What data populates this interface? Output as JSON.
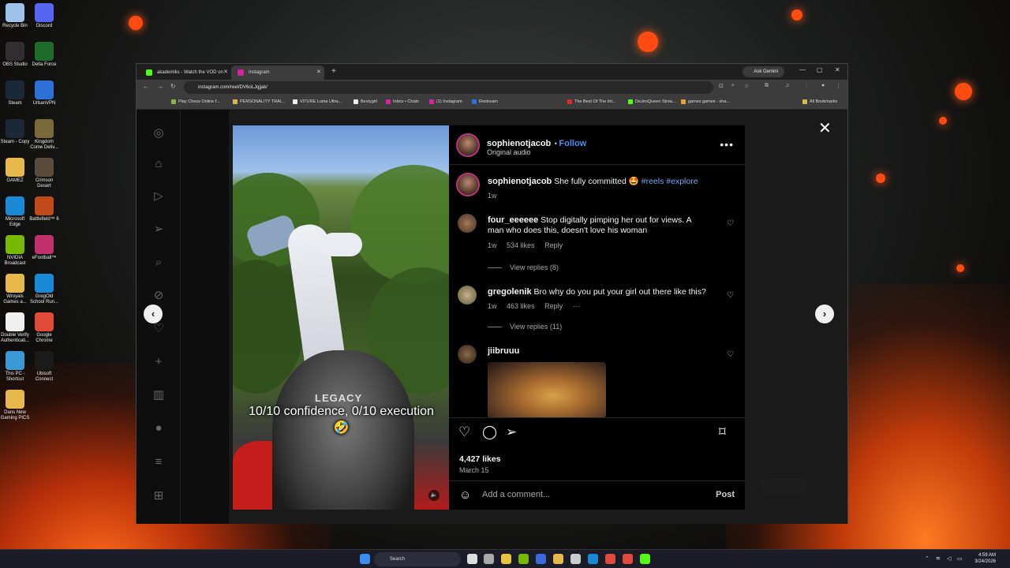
{
  "desktop": {
    "icons": [
      {
        "label": "Recycle Bin",
        "color": "#9fc2e8"
      },
      {
        "label": "Discord",
        "color": "#5865f2"
      },
      {
        "label": "OBS Studio",
        "color": "#302e31"
      },
      {
        "label": "Delta Force",
        "color": "#1f6b2e"
      },
      {
        "label": "Steam",
        "color": "#1b2838"
      },
      {
        "label": "UrbanVPN",
        "color": "#2f6fd8"
      },
      {
        "label": "Steam - Copy",
        "color": "#1b2838"
      },
      {
        "label": "Kingdom Come Deliv...",
        "color": "#7a6a3a"
      },
      {
        "label": "GAMEZ",
        "color": "#e6b94a"
      },
      {
        "label": "Crimson Desert",
        "color": "#5a4b3a"
      },
      {
        "label": "Microsoft Edge",
        "color": "#1a8ad8"
      },
      {
        "label": "Battlefield™ 6",
        "color": "#c04a1a"
      },
      {
        "label": "NVIDIA Broadcast",
        "color": "#76b900"
      },
      {
        "label": "eFootball™",
        "color": "#c0306a"
      },
      {
        "label": "Wroyals Games a...",
        "color": "#e6b94a"
      },
      {
        "label": "GregOld School Run...",
        "color": "#1a8ad8"
      },
      {
        "label": "Double Verify Authenticati...",
        "color": "#f0f0f0"
      },
      {
        "label": "Google Chrome",
        "color": "#e04a3a"
      },
      {
        "label": "This PC - Shortcut",
        "color": "#3a9ad8"
      },
      {
        "label": "Ubisoft Connect",
        "color": "#1a1a1a"
      },
      {
        "label": "Dans New Gaming PICS",
        "color": "#e6b94a"
      }
    ]
  },
  "browser": {
    "tabs": [
      {
        "title": "akademiks - Watch the VOD on",
        "fav_color": "#53fc18"
      },
      {
        "title": "Instagram",
        "fav_color": "#d6249f"
      }
    ],
    "ask_gemini": "Ask Gemini",
    "url": "instagram.com/reel/DV6oLJqjjak/",
    "bookmarks": [
      {
        "label": "Play Chess Online f...",
        "color": "#8fb34a"
      },
      {
        "label": "PERSONALITY TRAI...",
        "color": "#d8b84a"
      },
      {
        "label": "VITURE Luma Ultra...",
        "color": "#eeeeee"
      },
      {
        "label": "Bestygirl",
        "color": "#eeeeee"
      },
      {
        "label": "Inbox • Chats",
        "color": "#d6249f"
      },
      {
        "label": "(1) Instagram",
        "color": "#d6249f"
      },
      {
        "label": "Restream",
        "color": "#2f6fd8"
      },
      {
        "label": "The Best Of The Int...",
        "color": "#e02a2a"
      },
      {
        "label": "DeJenQueen Strea...",
        "color": "#53fc18"
      },
      {
        "label": "games games - sha...",
        "color": "#e6a23a"
      },
      {
        "label": "All Bookmarks",
        "color": "#d8b84a"
      }
    ]
  },
  "post": {
    "username": "sophienotjacob",
    "follow_label": "Follow",
    "audio": "Original audio",
    "caption_user": "sophienotjacob",
    "caption_text": "She fully committed 🤩",
    "caption_tags": "#reels #explore",
    "caption_age": "1w",
    "video_caption": "10/10 confidence, 0/10 execution🤣",
    "seat_brand": "LEGACY",
    "comments": [
      {
        "user": "four_eeeeee",
        "text": "Stop digitally pimping her out for views. A man who does this, doesn't love his woman",
        "age": "1w",
        "likes": "534 likes",
        "reply": "Reply",
        "view_replies": "View replies (8)"
      },
      {
        "user": "gregolenik",
        "text": "Bro why do you put your girl out there like this?",
        "age": "1w",
        "likes": "463 likes",
        "reply": "Reply",
        "more": "···",
        "view_replies": "View replies (11)"
      },
      {
        "user": "jiibruuu"
      }
    ],
    "likes": "4,427 likes",
    "date": "March 15",
    "add_comment_placeholder": "Add a comment...",
    "post_label": "Post"
  },
  "taskbar": {
    "search": "Search",
    "time": "4:59 AM",
    "date": "3/24/2026"
  }
}
